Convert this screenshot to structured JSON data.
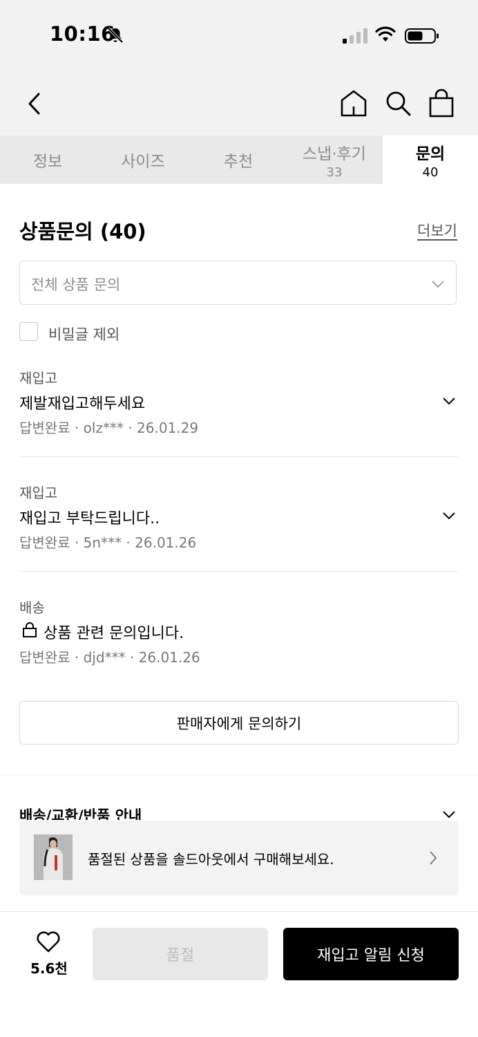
{
  "status_bar": {
    "time": "10:16"
  },
  "tabs": [
    {
      "label": "정보",
      "count": ""
    },
    {
      "label": "사이즈",
      "count": ""
    },
    {
      "label": "추천",
      "count": ""
    },
    {
      "label": "스냅·후기",
      "count": "33"
    },
    {
      "label": "문의",
      "count": "40",
      "active": true
    }
  ],
  "inquiry": {
    "title": "상품문의 (40)",
    "more_label": "더보기",
    "filter_placeholder": "전체 상품 문의",
    "exclude_secret_label": "비밀글 제외",
    "items": [
      {
        "category": "재입고",
        "title": "제발재입고해두세요",
        "meta": "답변완료 · olz*** · 26.01.29",
        "locked": false
      },
      {
        "category": "재입고",
        "title": "재입고 부탁드립니다..",
        "meta": "답변완료 · 5n*** · 26.01.26",
        "locked": false
      },
      {
        "category": "배송",
        "title": "상품 관련 문의입니다.",
        "meta": "답변완료 · djd*** · 26.01.26",
        "locked": true
      }
    ],
    "ask_button_label": "판매자에게 문의하기"
  },
  "shipping": {
    "title": "배송/교환/반품 안내"
  },
  "banner": {
    "text": "품절된 상품을 솔드아웃에서 구매해보세요."
  },
  "bottom_bar": {
    "like_count": "5.6천",
    "soldout_label": "품절",
    "notify_label": "재입고 알림 신청"
  }
}
